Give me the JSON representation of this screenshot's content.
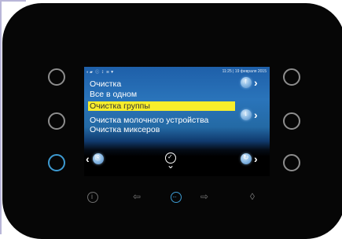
{
  "status_bar": {
    "icons": "◐▰ ⓘ ⟟ ≋▼",
    "datetime": "11:25 | 19 февраля 2015"
  },
  "menu": {
    "items": [
      {
        "label": "Очистка"
      },
      {
        "label": "Все в одном"
      },
      {
        "label": "Очистка группы",
        "selected": true
      },
      {
        "label": "Очистка молочного устройства"
      },
      {
        "label": "Очистка миксеров"
      }
    ]
  },
  "controls": {
    "up_glyph": "↑",
    "down_glyph": "↓",
    "back_glyph": "⎘",
    "refresh_glyph": "↻",
    "confirm_glyph": "✓",
    "left_chevron": "‹",
    "right_chevron": "›",
    "down_chevron": "⌄"
  },
  "bottom_bar": {
    "info_glyph": "i",
    "left_arrow": "⇦",
    "menu_glyph": "···",
    "right_arrow": "⇨",
    "drop_glyph": "◊"
  },
  "colors": {
    "panel": "#060606",
    "accent_blue": "#3d9ad1",
    "selection": "#f8ee2b"
  }
}
